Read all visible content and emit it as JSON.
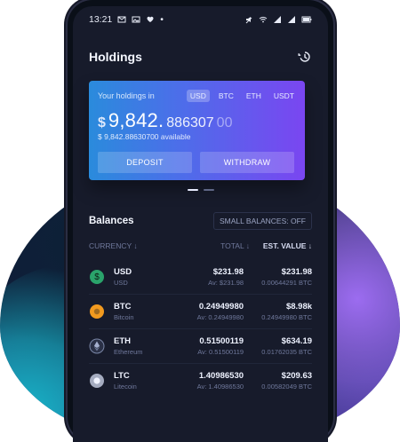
{
  "status_bar": {
    "time": "13:21",
    "left_icons": [
      "mail-icon",
      "image-icon",
      "heart-icon",
      "dot-icon"
    ],
    "right_icons": [
      "mute-icon",
      "wifi-icon",
      "signal-icon",
      "signal-icon",
      "battery-icon"
    ]
  },
  "header": {
    "title": "Holdings"
  },
  "card": {
    "label": "Your holdings in",
    "currency_tabs": [
      "USD",
      "BTC",
      "ETH",
      "USDT"
    ],
    "selected_currency": "USD",
    "amount_symbol": "$",
    "amount_integer": "9,842.",
    "amount_decimals": "886307",
    "amount_decimals_faded": "00",
    "available_text": "$ 9,842.88630700 available",
    "deposit_label": "DEPOSIT",
    "withdraw_label": "WITHDRAW"
  },
  "pager": {
    "pages": 2,
    "active_index": 0
  },
  "balances": {
    "title": "Balances",
    "small_balances_label": "SMALL BALANCES: OFF",
    "headers": {
      "currency": "CURRENCY ↓",
      "total": "TOTAL ↓",
      "est_value": "EST. VALUE ↓"
    },
    "rows": [
      {
        "icon": "usd-coin-icon",
        "color": "#2aa36b",
        "symbol": "USD",
        "name": "USD",
        "total": "$231.98",
        "available": "Av: $231.98",
        "est_value": "$231.98",
        "est_sub": "0.00644291 BTC"
      },
      {
        "icon": "bitcoin-icon",
        "color": "#f29a1f",
        "symbol": "BTC",
        "name": "Bitcoin",
        "total": "0.24949980",
        "available": "Av: 0.24949980",
        "est_value": "$8.98k",
        "est_sub": "0.24949980 BTC"
      },
      {
        "icon": "ethereum-icon",
        "color": "#7a86a6",
        "symbol": "ETH",
        "name": "Ethereum",
        "total": "0.51500119",
        "available": "Av: 0.51500119",
        "est_value": "$634.19",
        "est_sub": "0.01762035 BTC"
      },
      {
        "icon": "litecoin-icon",
        "color": "#a5acc0",
        "symbol": "LTC",
        "name": "Litecoin",
        "total": "1.40986530",
        "available": "Av: 1.40986530",
        "est_value": "$209.63",
        "est_sub": "0.00582049 BTC"
      }
    ]
  }
}
